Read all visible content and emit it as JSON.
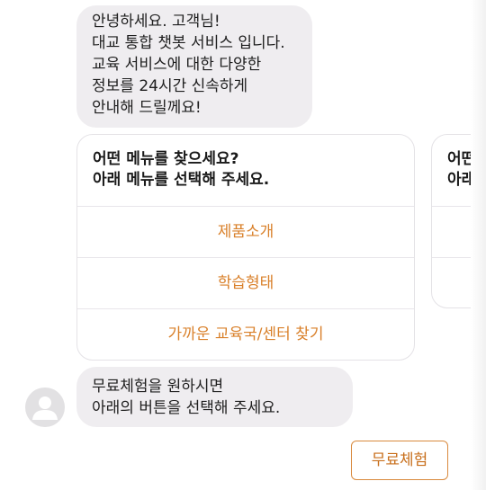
{
  "greeting": {
    "lines": [
      "안녕하세요. 고객님!",
      "대교 통합 챗봇 서비스 입니다.",
      "교육 서비스에 대한 다양한",
      "정보를 24시간 신속하게",
      "안내해 드릴께요!"
    ]
  },
  "menu_card": {
    "prompt_lines": [
      "어떤 메뉴를 찾으세요?",
      "아래 메뉴를 선택해 주세요."
    ],
    "items": [
      "제품소개",
      "학습형태",
      "가까운 교육국/센터 찾기"
    ]
  },
  "next_card": {
    "prompt_lines": [
      "어떤",
      "아래"
    ]
  },
  "trial_message": {
    "lines": [
      "무료체험을 원하시면",
      "아래의 버튼을 선택해 주세요."
    ]
  },
  "trial_button": {
    "label": "무료체험"
  },
  "colors": {
    "accent": "#d9802a",
    "bubble": "#efedf0",
    "border": "#e4e2e6"
  },
  "icons": {
    "avatar": "user-silhouette-icon"
  }
}
